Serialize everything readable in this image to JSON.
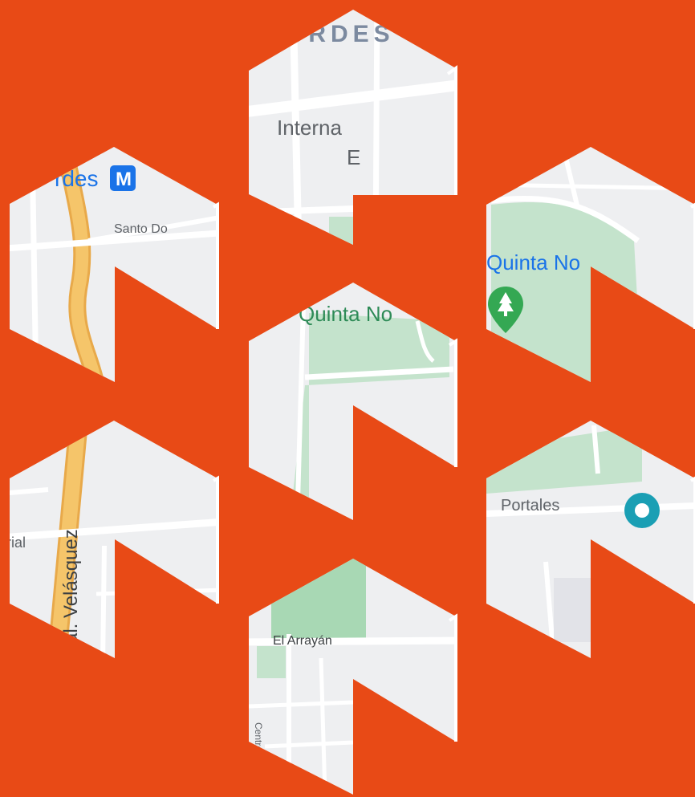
{
  "background_color": "#e84a16",
  "map_colors": {
    "land": "#eeeff1",
    "road": "#ffffff",
    "park": "#c4e3cc",
    "park_dark": "#a8d8b4",
    "highway": "#f5c56a",
    "highway_edge": "#e8a94a",
    "label_dark": "#5f6368",
    "label_blue": "#1a73e8",
    "label_green": "#2e8b57",
    "metro_blue": "#1a73e8",
    "pin_green": "#34a853",
    "poi_teal": "#1a9fb4"
  },
  "tiles": [
    {
      "name": "top-center",
      "labels": {
        "district": "ORDES",
        "street": "Interna",
        "suffix": "E"
      }
    },
    {
      "name": "upper-left",
      "labels": {
        "station": "rdes",
        "metro": "M",
        "street": "Santo Do"
      }
    },
    {
      "name": "upper-right",
      "labels": {
        "park": "Quinta No",
        "icon": "tree-pin-icon"
      }
    },
    {
      "name": "center",
      "labels": {
        "park": "Quinta No"
      }
    },
    {
      "name": "lower-left",
      "labels": {
        "avenue": "ral. Velásquez",
        "street": "rial"
      }
    },
    {
      "name": "lower-right",
      "labels": {
        "street": "Portales",
        "icon": "poi-icon"
      }
    },
    {
      "name": "bottom-center",
      "labels": {
        "street": "El Arrayán",
        "side": "Centro"
      }
    }
  ]
}
